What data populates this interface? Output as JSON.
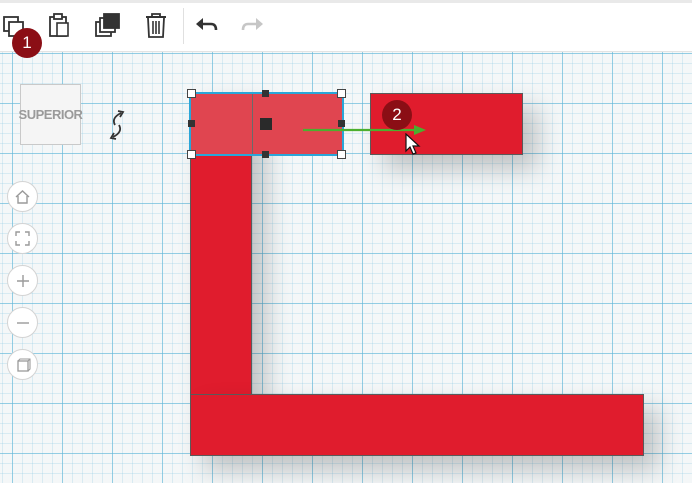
{
  "toolbar": {
    "buttons": [
      {
        "name": "copy",
        "icon": "copy-icon"
      },
      {
        "name": "paste",
        "icon": "paste-icon"
      },
      {
        "name": "duplicate",
        "icon": "duplicate-icon"
      },
      {
        "name": "delete",
        "icon": "trash-icon"
      },
      {
        "name": "undo",
        "icon": "undo-icon"
      },
      {
        "name": "redo",
        "icon": "redo-icon",
        "disabled": true
      }
    ]
  },
  "viewcube": {
    "label": "SUPERIOR"
  },
  "nav_controls": [
    {
      "name": "home-view",
      "icon": "home-icon"
    },
    {
      "name": "fit-all",
      "icon": "fit-view-icon"
    },
    {
      "name": "zoom-in",
      "icon": "plus-icon"
    },
    {
      "name": "zoom-out",
      "icon": "minus-icon"
    },
    {
      "name": "ortho-view",
      "icon": "cube-view-icon"
    }
  ],
  "annotations": [
    {
      "number": "1"
    },
    {
      "number": "2"
    }
  ],
  "colors": {
    "shape_red": "#e01c2d",
    "selection_outline": "#2aa6d8",
    "move_arrow": "#4caf2e",
    "badge": "#8b0e15",
    "grid_line": "#5ab4d7"
  }
}
